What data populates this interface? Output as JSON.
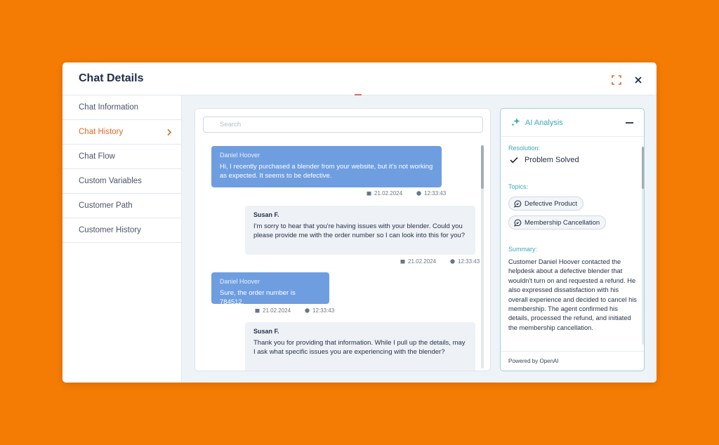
{
  "modal": {
    "title": "Chat Details"
  },
  "sidebar": {
    "items": [
      {
        "label": "Chat Information",
        "active": false
      },
      {
        "label": "Chat History",
        "active": true
      },
      {
        "label": "Chat Flow",
        "active": false
      },
      {
        "label": "Custom Variables",
        "active": false
      },
      {
        "label": "Customer Path",
        "active": false
      },
      {
        "label": "Customer History",
        "active": false
      }
    ]
  },
  "chat": {
    "search_placeholder": "Search",
    "messages": [
      {
        "sender": "Daniel Hoover",
        "role": "customer-bubble-blue",
        "text": "Hi, I recently purchased a blender from your website, but it's not working as expected. It seems to be defective.",
        "date": "21.02.2024",
        "time": "12:33:43"
      },
      {
        "sender": "Susan F.",
        "role": "agent-bubble-grey",
        "text": "I'm sorry to hear that you're having issues with your blender. Could you please provide me with the order number so I can look into this for you?",
        "date": "21.02.2024",
        "time": "12:33:43"
      },
      {
        "sender": "Daniel Hoover",
        "role": "customer-bubble-blue",
        "text": "Sure, the order number is 784512.",
        "date": "21.02.2024",
        "time": "12:33:43"
      },
      {
        "sender": "Susan F.",
        "role": "agent-bubble-grey",
        "text": "Thank you for providing that information. While I pull up the details, may I ask what specific issues you are experiencing with the blender?"
      }
    ]
  },
  "ai_analysis": {
    "title": "AI Analysis",
    "resolution_label": "Resolution:",
    "resolution_value": "Problem Solved",
    "topics_label": "Topics:",
    "topics": [
      "Defective Product",
      "Membership Cancellation"
    ],
    "summary_label": "Summary:",
    "summary": "Customer Daniel Hoover contacted the helpdesk about a defective blender that wouldn't turn on and requested a refund. He also expressed dissatisfaction with his overall experience and decided to cancel his membership. The agent confirmed his details, processed the refund, and initiated the membership cancellation.",
    "footer": "Powered by OpenAI"
  },
  "colors": {
    "background": "#f47b04",
    "accent_active": "#e06a2b",
    "user_bubble": "#6f9ee0",
    "agent_bubble": "#eef1f5",
    "ai_accent": "#3fa8b6"
  }
}
